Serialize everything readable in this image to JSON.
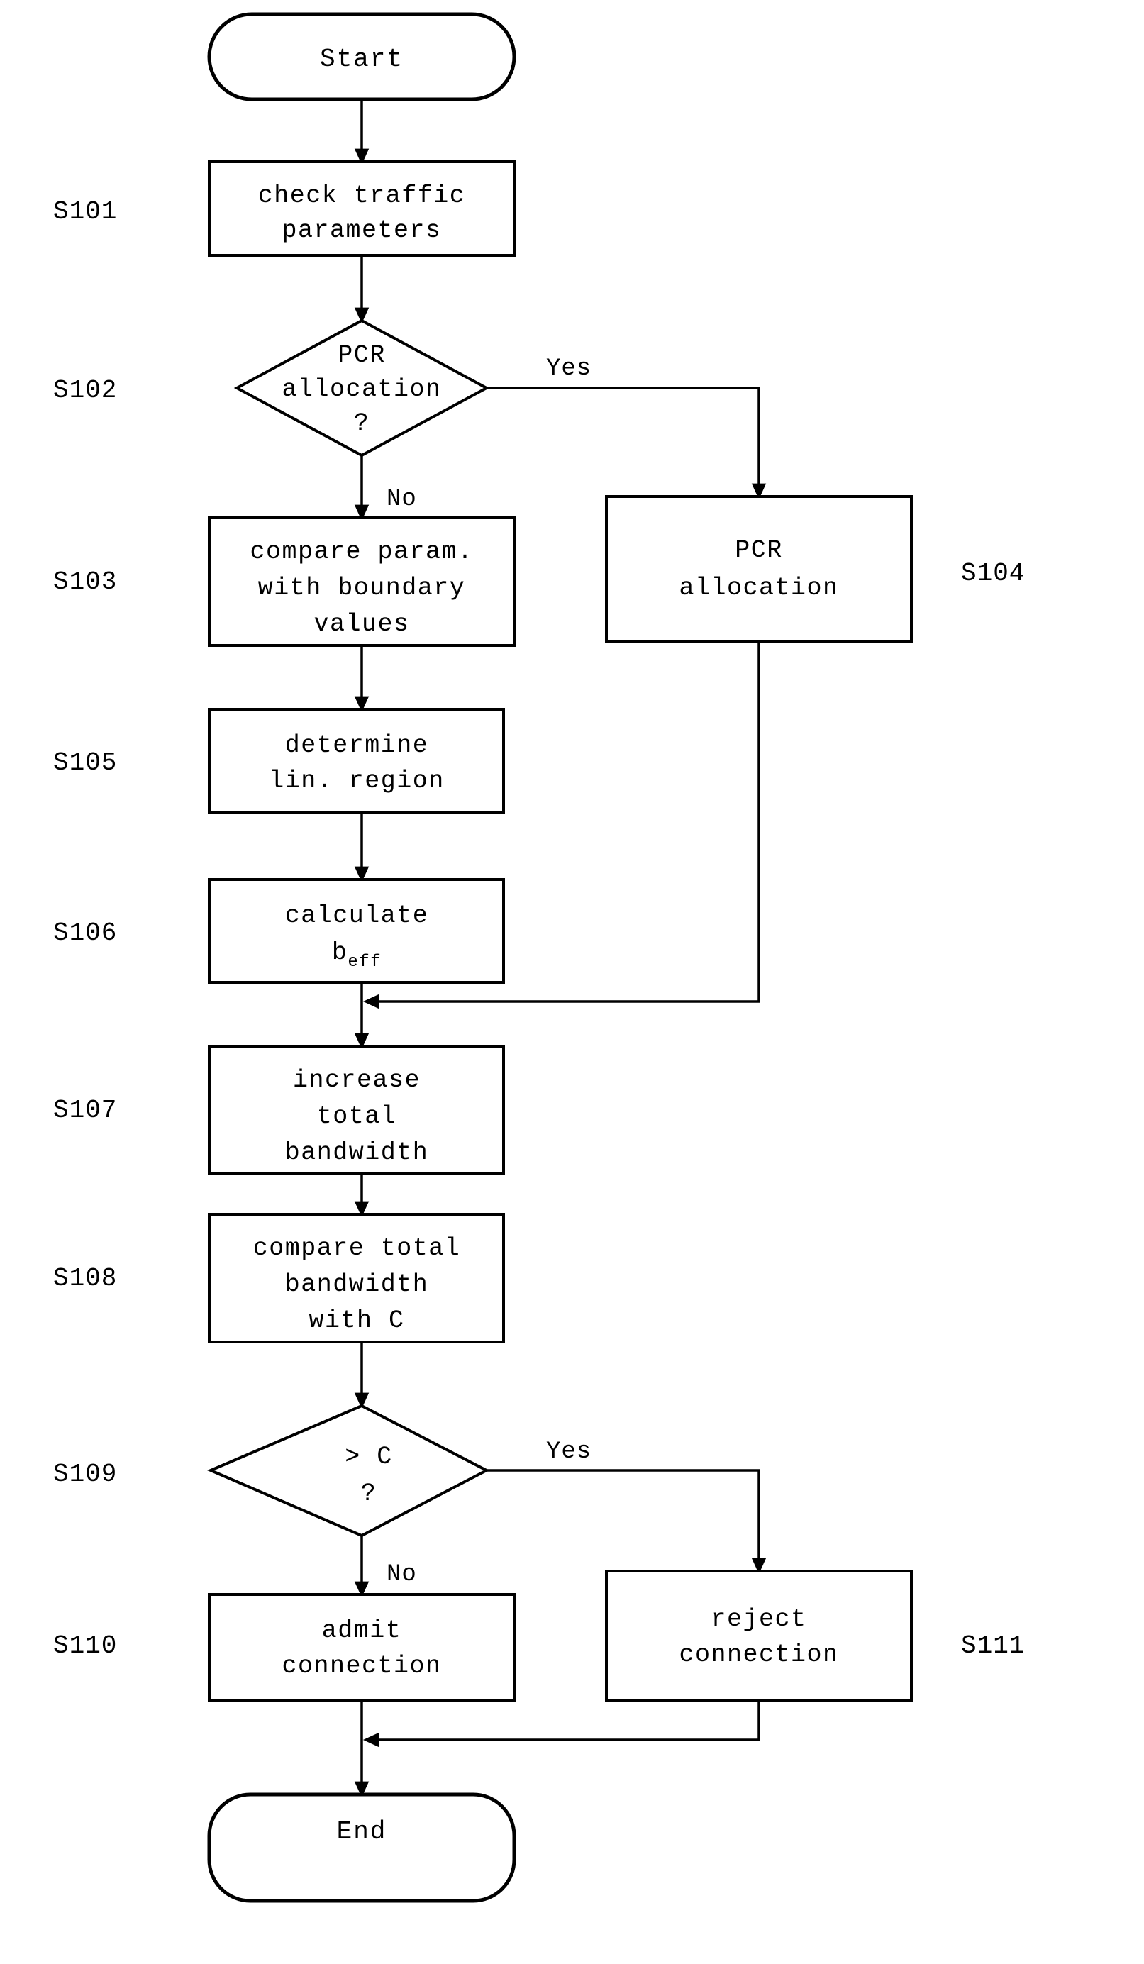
{
  "figure": {
    "type": "flowchart",
    "orientation": "vertical",
    "background_color": "#ffffff",
    "line_color": "#000000"
  },
  "nodes": {
    "start": {
      "label": "Start",
      "shape": "terminator"
    },
    "end": {
      "label": "End",
      "shape": "terminator"
    },
    "s101": {
      "step": "S101",
      "shape": "process",
      "line1": "check traffic",
      "line2": "parameters"
    },
    "s102": {
      "step": "S102",
      "shape": "decision",
      "line1": "PCR",
      "line2": "allocation",
      "line3": "?"
    },
    "s103": {
      "step": "S103",
      "shape": "process",
      "line1": "compare param.",
      "line2": "with boundary",
      "line3": "values"
    },
    "s104": {
      "step": "S104",
      "shape": "process",
      "line1": "PCR",
      "line2": "allocation"
    },
    "s105": {
      "step": "S105",
      "shape": "process",
      "line1": "determine",
      "line2": "lin. region"
    },
    "s106": {
      "step": "S106",
      "shape": "process",
      "line1": "calculate",
      "line2_base": "b",
      "line2_sub": "eff"
    },
    "s107": {
      "step": "S107",
      "shape": "process",
      "line1": "increase",
      "line2": "total",
      "line3": "bandwidth"
    },
    "s108": {
      "step": "S108",
      "shape": "process",
      "line1": "compare total",
      "line2": "bandwidth",
      "line3": "with C"
    },
    "s109": {
      "step": "S109",
      "shape": "decision",
      "line1": "> C",
      "line2": "?"
    },
    "s110": {
      "step": "S110",
      "shape": "process",
      "line1": "admit",
      "line2": "connection"
    },
    "s111": {
      "step": "S111",
      "shape": "process",
      "line1": "reject",
      "line2": "connection"
    }
  },
  "edge_labels": {
    "s102_yes": "Yes",
    "s102_no": "No",
    "s109_yes": "Yes",
    "s109_no": "No"
  }
}
